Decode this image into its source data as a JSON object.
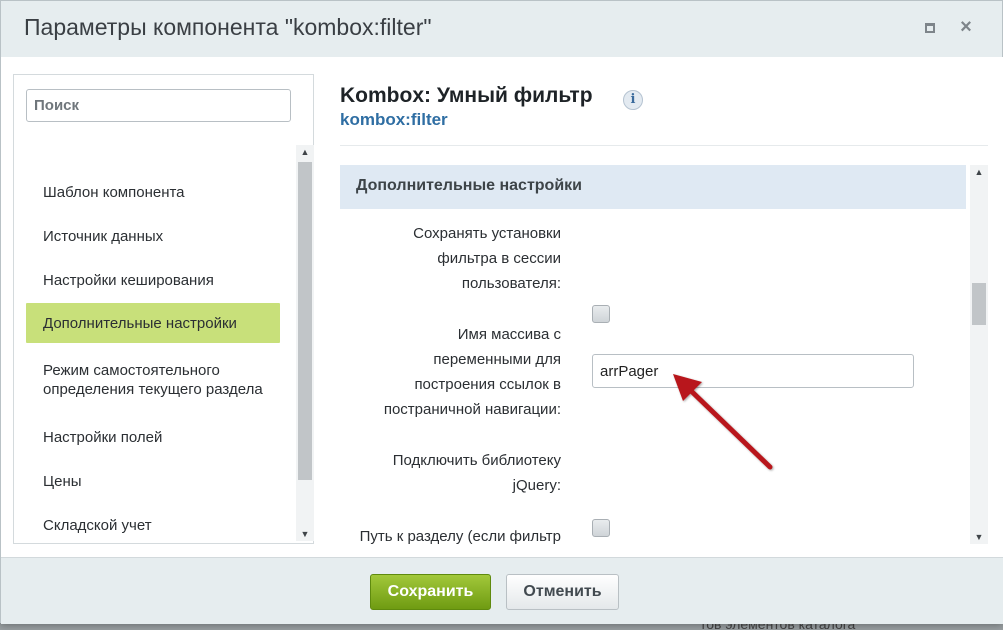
{
  "background": {
    "text": "тов элементов каталога"
  },
  "dialog": {
    "title": "Параметры компонента \"kombox:filter\""
  },
  "sidebar": {
    "search_placeholder": "Поиск",
    "items": [
      {
        "label": "Шаблон компонента",
        "active": false
      },
      {
        "label": "Источник данных",
        "active": false
      },
      {
        "label": "Настройки кеширования",
        "active": false
      },
      {
        "label": "Дополнительные настройки",
        "active": true
      },
      {
        "label": "Режим самостоятельного определения текущего раздела",
        "active": false
      },
      {
        "label": "Настройки полей",
        "active": false
      },
      {
        "label": "Цены",
        "active": false
      },
      {
        "label": "Складской учет",
        "active": false
      }
    ]
  },
  "component": {
    "name": "Kombox: Умный фильтр",
    "code": "kombox:filter",
    "info_icon": "i"
  },
  "section": {
    "title": "Дополнительные настройки",
    "params": [
      {
        "label_lines": [
          "Сохранять установки",
          "фильтра в сессии",
          "пользователя:"
        ],
        "control": "checkbox",
        "checked": false
      },
      {
        "label_lines": [
          "Имя массива с",
          "переменными для",
          "построения ссылок в",
          "постраничной навигации:"
        ],
        "control": "text",
        "value": "arrPager"
      },
      {
        "label_lines": [
          "Подключить библиотеку",
          "jQuery:"
        ],
        "control": "checkbox",
        "checked": false
      },
      {
        "label_lines": [
          "Путь к разделу (если фильтр"
        ],
        "control": "none"
      }
    ]
  },
  "footer": {
    "save_label": "Сохранить",
    "cancel_label": "Отменить"
  },
  "colors": {
    "accent_green": "#8db52a",
    "active_item": "#c8e07a",
    "link_blue": "#2f6ea3",
    "section_head": "#dfe9f3",
    "arrow_red": "#b8191a"
  }
}
